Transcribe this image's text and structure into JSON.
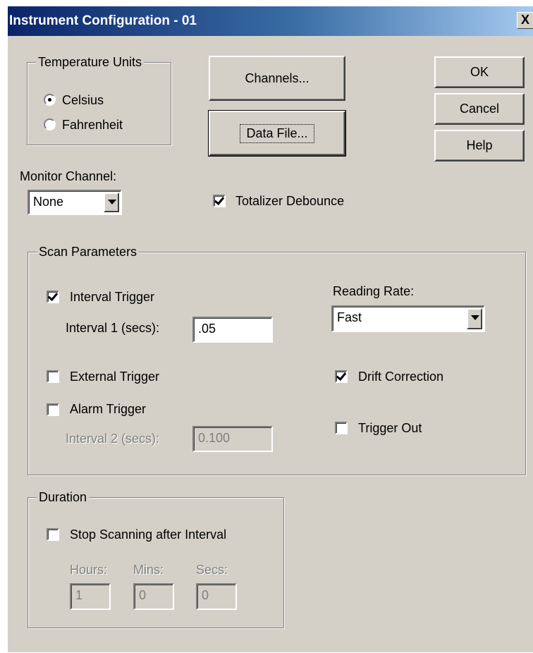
{
  "window": {
    "title": "Instrument Configuration - 01",
    "close_glyph": "X"
  },
  "temperature_units": {
    "group_label": "Temperature Units",
    "options": [
      {
        "label": "Celsius",
        "selected": true
      },
      {
        "label": "Fahrenheit",
        "selected": false
      }
    ]
  },
  "buttons": {
    "channels": "Channels...",
    "data_file": "Data File...",
    "ok": "OK",
    "cancel": "Cancel",
    "help": "Help"
  },
  "monitor_channel": {
    "label": "Monitor Channel:",
    "value": "None"
  },
  "totalizer_debounce": {
    "label": "Totalizer Debounce",
    "checked": true
  },
  "scan_parameters": {
    "group_label": "Scan Parameters",
    "interval_trigger": {
      "label": "Interval Trigger",
      "checked": true
    },
    "interval1": {
      "label": "Interval 1 (secs):",
      "value": ".05"
    },
    "external_trigger": {
      "label": "External Trigger",
      "checked": false
    },
    "alarm_trigger": {
      "label": "Alarm Trigger",
      "checked": false
    },
    "interval2": {
      "label": "Interval 2 (secs):",
      "value": "0.100",
      "enabled": false
    },
    "reading_rate": {
      "label": "Reading Rate:",
      "value": "Fast"
    },
    "drift_correction": {
      "label": "Drift Correction",
      "checked": true
    },
    "trigger_out": {
      "label": "Trigger Out",
      "checked": false
    }
  },
  "duration": {
    "group_label": "Duration",
    "stop_scanning": {
      "label": "Stop Scanning after Interval",
      "checked": false
    },
    "hours": {
      "label": "Hours:",
      "value": "1"
    },
    "mins": {
      "label": "Mins:",
      "value": "0"
    },
    "secs": {
      "label": "Secs:",
      "value": "0"
    }
  }
}
